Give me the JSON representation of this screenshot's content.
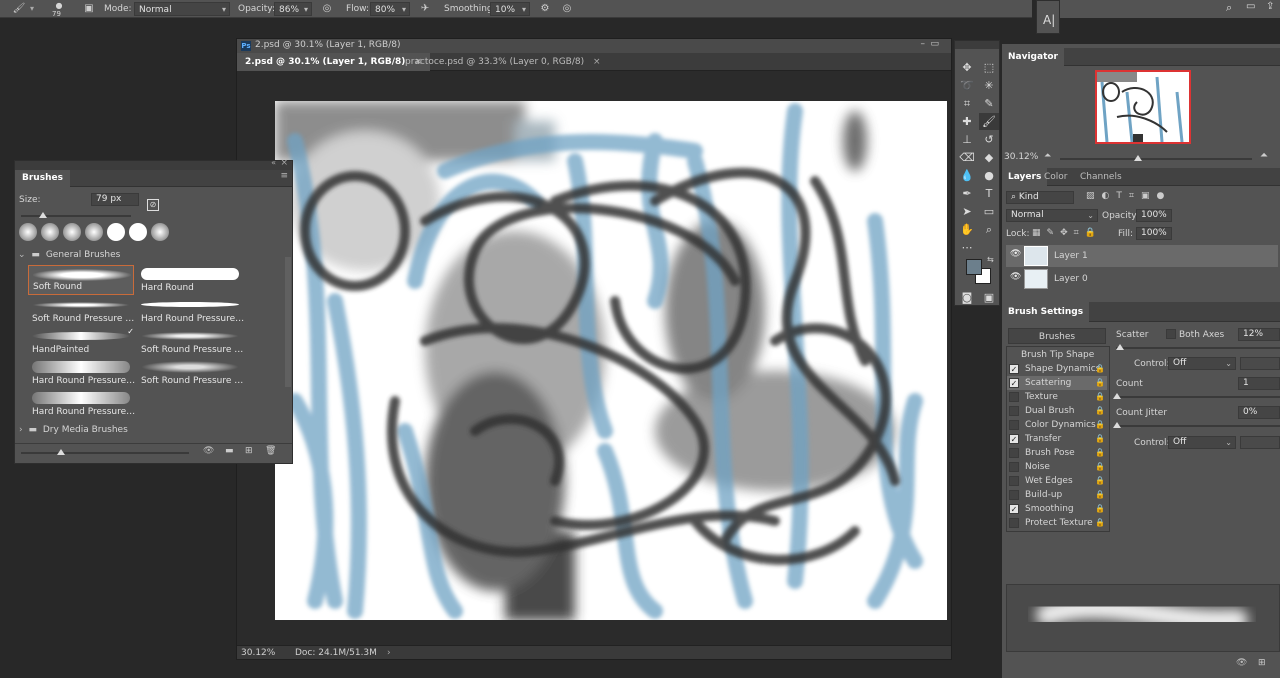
{
  "options_bar": {
    "brush_size": "79",
    "mode_label": "Mode:",
    "mode_value": "Normal",
    "opacity_label": "Opacity:",
    "opacity_value": "86%",
    "flow_label": "Flow:",
    "flow_value": "80%",
    "smoothing_label": "Smoothing:",
    "smoothing_value": "10%"
  },
  "document": {
    "title": "2.psd @ 30.1% (Layer 1, RGB/8)",
    "tabs": [
      {
        "label": "2.psd @ 30.1% (Layer 1, RGB/8)"
      },
      {
        "label": "practoce.psd @ 33.3% (Layer 0, RGB/8)"
      }
    ],
    "zoom": "30.12%",
    "doc_size": "Doc: 24.1M/51.3M"
  },
  "brushes_panel": {
    "title": "Brushes",
    "size_label": "Size:",
    "size_value": "79 px",
    "size_fraction": 0.2,
    "group_open": "General Brushes",
    "group_closed": "Dry Media Brushes",
    "presets": [
      {
        "label": "Soft Round"
      },
      {
        "label": "Hard Round"
      },
      {
        "label": "Soft Round Pressure Size"
      },
      {
        "label": "Hard Round Pressure Size"
      },
      {
        "label": "HandPainted"
      },
      {
        "label": "Soft Round Pressure Opa..."
      },
      {
        "label": "Hard Round Pressure Op..."
      },
      {
        "label": "Soft Round Pressure Opa..."
      },
      {
        "label": "Hard Round Pressure Op..."
      }
    ]
  },
  "navigator": {
    "title": "Navigator",
    "zoom": "30.12%"
  },
  "layers": {
    "tabs": [
      "Layers",
      "Color",
      "Channels"
    ],
    "filter_value": "Kind",
    "blend_mode": "Normal",
    "opacity_label": "Opacity:",
    "opacity_value": "100%",
    "lock_label": "Lock:",
    "fill_label": "Fill:",
    "fill_value": "100%",
    "items": [
      {
        "name": "Layer 1"
      },
      {
        "name": "Layer 0"
      }
    ]
  },
  "brush_settings": {
    "title": "Brush Settings",
    "brushes_button": "Brushes",
    "items": [
      {
        "label": "Brush Tip Shape",
        "checked": null
      },
      {
        "label": "Shape Dynamics",
        "checked": true
      },
      {
        "label": "Scattering",
        "checked": true
      },
      {
        "label": "Texture",
        "checked": false
      },
      {
        "label": "Dual Brush",
        "checked": false
      },
      {
        "label": "Color Dynamics",
        "checked": false
      },
      {
        "label": "Transfer",
        "checked": true
      },
      {
        "label": "Brush Pose",
        "checked": false
      },
      {
        "label": "Noise",
        "checked": false
      },
      {
        "label": "Wet Edges",
        "checked": false
      },
      {
        "label": "Build-up",
        "checked": false
      },
      {
        "label": "Smoothing",
        "checked": true
      },
      {
        "label": "Protect Texture",
        "checked": false
      }
    ],
    "scatter_label": "Scatter",
    "both_axes_label": "Both Axes",
    "scatter_value": "12%",
    "control_label": "Control:",
    "control_value": "Off",
    "count_label": "Count",
    "count_value": "1",
    "count_jitter_label": "Count Jitter",
    "count_jitter_value": "0%",
    "control2_label": "Control:",
    "control2_value": "Off"
  },
  "colors": {
    "fg": "#6c7f8c",
    "bg": "#ffffff",
    "panel": "#535353",
    "selection": "#c96b3a"
  }
}
